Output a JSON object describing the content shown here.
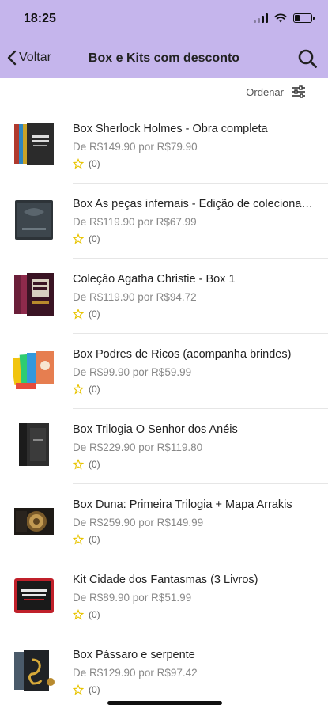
{
  "status_bar": {
    "time": "18:25"
  },
  "nav": {
    "back_label": "Voltar",
    "title": "Box e Kits com desconto"
  },
  "sort": {
    "label": "Ordenar"
  },
  "colors": {
    "header_bg": "#c5b5ec",
    "star": "#e8c400"
  },
  "products": [
    {
      "title": "Box Sherlock Holmes - Obra completa",
      "price": "De R$149.90 por R$79.90",
      "rating_count": "(0)",
      "cover_icon": "book-box-dark"
    },
    {
      "title": "Box As peças infernais - Edição de colecionador",
      "price": "De R$119.90 por R$67.99",
      "rating_count": "(0)",
      "cover_icon": "book-box-black"
    },
    {
      "title": "Coleção Agatha Christie - Box 1",
      "price": "De R$119.90 por R$94.72",
      "rating_count": "(0)",
      "cover_icon": "book-box-red"
    },
    {
      "title": "Box Podres de Ricos (acompanha brindes)",
      "price": "De R$99.90 por R$59.99",
      "rating_count": "(0)",
      "cover_icon": "book-set-colorful"
    },
    {
      "title": "Box Trilogia O Senhor dos Anéis",
      "price": "De R$229.90 por R$119.80",
      "rating_count": "(0)",
      "cover_icon": "book-box-black-tall"
    },
    {
      "title": "Box Duna: Primeira Trilogia + Mapa Arrakis",
      "price": "De R$259.90 por R$149.99",
      "rating_count": "(0)",
      "cover_icon": "book-box-gold"
    },
    {
      "title": "Kit Cidade dos Fantasmas (3 Livros)",
      "price": "De R$89.90 por R$51.99",
      "rating_count": "(0)",
      "cover_icon": "book-kit-red"
    },
    {
      "title": "Box Pássaro e serpente",
      "price": "De R$129.90 por R$97.42",
      "rating_count": "(0)",
      "cover_icon": "book-box-gold-serpent"
    }
  ]
}
